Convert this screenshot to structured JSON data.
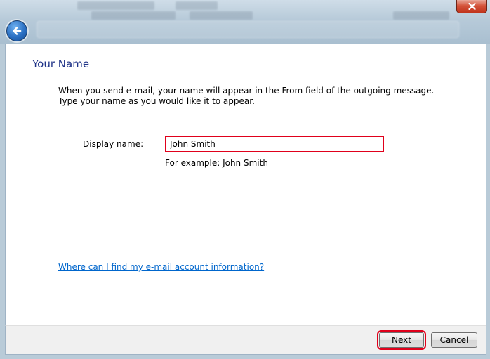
{
  "window": {
    "back_icon": "back-arrow-icon",
    "close_icon": "close-icon"
  },
  "page": {
    "title": "Your Name",
    "instruction_line1": "When you send e-mail, your name will appear in the From field of the outgoing message.",
    "instruction_line2": "Type your name as you would like it to appear."
  },
  "form": {
    "display_name_label": "Display name:",
    "display_name_value": "John Smith",
    "example_text": "For example: John Smith"
  },
  "help_link": "Where can I find my e-mail account information?",
  "footer": {
    "next_label": "Next",
    "cancel_label": "Cancel"
  },
  "colors": {
    "title": "#1e3287",
    "link": "#0066cc",
    "highlight": "#e0001b"
  }
}
